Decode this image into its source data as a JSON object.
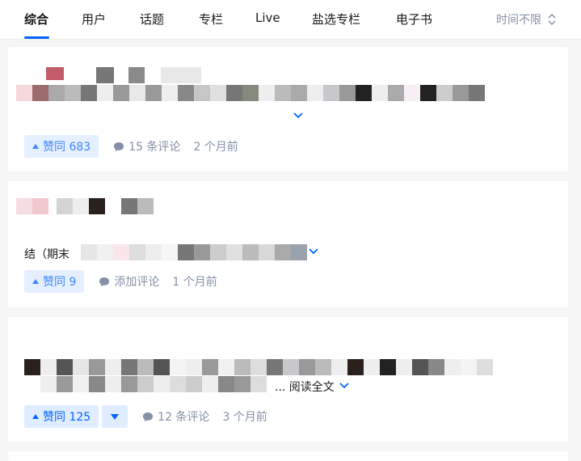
{
  "tabs": [
    "综合",
    "用户",
    "话题",
    "专栏",
    "Live",
    "盐选专栏",
    "电子书"
  ],
  "time_filter": "时间不限",
  "colors": {
    "accent": "#0066ff",
    "meta": "#8590a6",
    "vote_bg": "#e5efff"
  },
  "cards": [
    {
      "vote_label": "赞同 683",
      "comments": "15 条评论",
      "time": "2 个月前"
    },
    {
      "snippet": "结（期末",
      "vote_label": "赞同 9",
      "comments": "添加评论",
      "time": "1 个月前"
    },
    {
      "read_more": "... 阅读全文",
      "vote_label": "赞同 125",
      "comments": "12 条评论",
      "time": "3 个月前"
    }
  ]
}
